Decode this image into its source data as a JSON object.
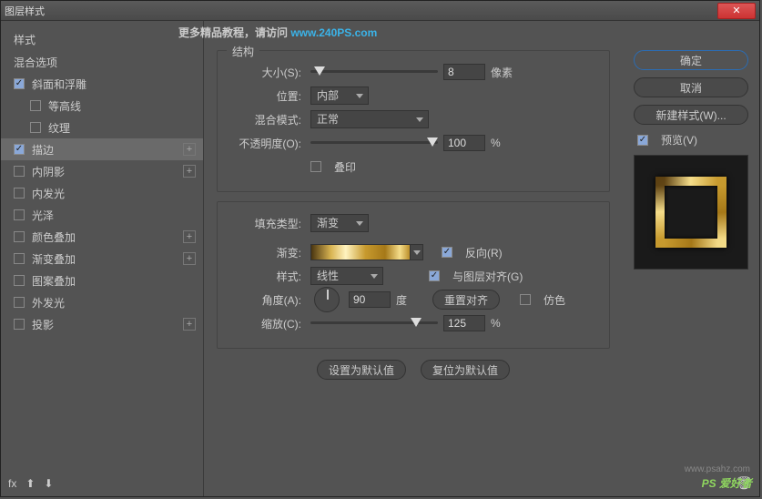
{
  "window": {
    "title": "图层样式"
  },
  "promo": {
    "text_a": "更多精品教程，请访问 ",
    "url": "www.240PS.com"
  },
  "sidebar": {
    "header": "样式",
    "blend": "混合选项",
    "items": [
      {
        "label": "斜面和浮雕",
        "checked": true,
        "plus": false,
        "sub": false
      },
      {
        "label": "等高线",
        "checked": false,
        "plus": false,
        "sub": true
      },
      {
        "label": "纹理",
        "checked": false,
        "plus": false,
        "sub": true
      },
      {
        "label": "描边",
        "checked": true,
        "plus": true,
        "sub": false,
        "selected": true
      },
      {
        "label": "内阴影",
        "checked": false,
        "plus": true,
        "sub": false
      },
      {
        "label": "内发光",
        "checked": false,
        "plus": false,
        "sub": false
      },
      {
        "label": "光泽",
        "checked": false,
        "plus": false,
        "sub": false
      },
      {
        "label": "颜色叠加",
        "checked": false,
        "plus": true,
        "sub": false
      },
      {
        "label": "渐变叠加",
        "checked": false,
        "plus": true,
        "sub": false
      },
      {
        "label": "图案叠加",
        "checked": false,
        "plus": false,
        "sub": false
      },
      {
        "label": "外发光",
        "checked": false,
        "plus": false,
        "sub": false
      },
      {
        "label": "投影",
        "checked": false,
        "plus": true,
        "sub": false
      }
    ],
    "footer": {
      "fx": "fx"
    }
  },
  "structure": {
    "title": "结构",
    "size_label": "大小(S):",
    "size_value": "8",
    "size_unit": "像素",
    "position_label": "位置:",
    "position_value": "内部",
    "blend_label": "混合模式:",
    "blend_value": "正常",
    "opacity_label": "不透明度(O):",
    "opacity_value": "100",
    "opacity_unit": "%",
    "overprint_label": "叠印"
  },
  "fill": {
    "type_label": "填充类型:",
    "type_value": "渐变",
    "gradient_label": "渐变:",
    "reverse_label": "反向(R)",
    "style_label": "样式:",
    "style_value": "线性",
    "align_label": "与图层对齐(G)",
    "angle_label": "角度(A):",
    "angle_value": "90",
    "angle_unit": "度",
    "reset_align": "重置对齐",
    "dither_label": "仿色",
    "scale_label": "缩放(C):",
    "scale_value": "125",
    "scale_unit": "%"
  },
  "buttons": {
    "set_default": "设置为默认值",
    "reset_default": "复位为默认值"
  },
  "right": {
    "ok": "确定",
    "cancel": "取消",
    "new_style": "新建样式(W)...",
    "preview": "预览(V)"
  },
  "watermark": {
    "site": "www.psahz.com",
    "logo": "PS 爱好者"
  }
}
